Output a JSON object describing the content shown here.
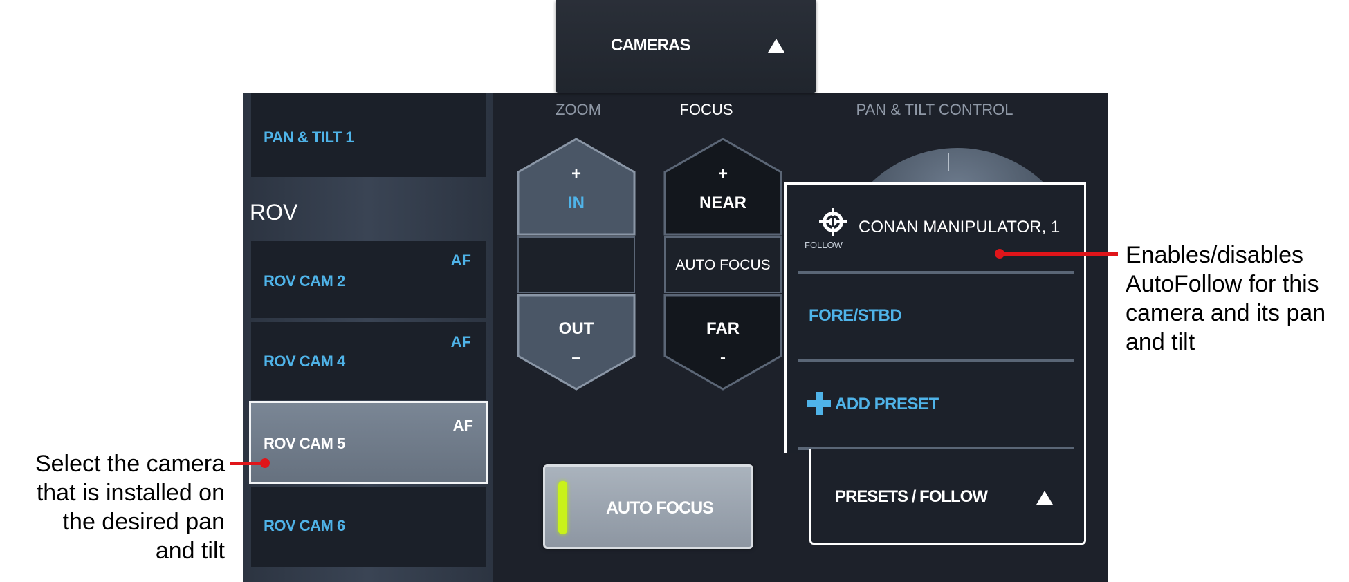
{
  "cameras_tab": {
    "label": "CAMERAS"
  },
  "sidebar": {
    "group_header": "ROV",
    "items": [
      {
        "label": "PAN & TILT 1",
        "af": ""
      },
      {
        "label": "ROV CAM 2",
        "af": "AF"
      },
      {
        "label": "ROV CAM 4",
        "af": "AF"
      },
      {
        "label": "ROV CAM 5",
        "af": "AF",
        "selected": true
      },
      {
        "label": "ROV CAM 6",
        "af": ""
      }
    ]
  },
  "columns": {
    "zoom": "ZOOM",
    "focus": "FOCUS",
    "pan_tilt": "PAN & TILT CONTROL"
  },
  "zoom_control": {
    "plus": "+",
    "in": "IN",
    "out": "OUT",
    "minus": "–"
  },
  "focus_control": {
    "plus": "+",
    "near": "NEAR",
    "auto": "AUTO FOCUS",
    "far": "FAR",
    "minus": "-"
  },
  "auto_focus_button": {
    "label": "AUTO FOCUS",
    "led_color": "#c9f21a"
  },
  "presets": {
    "follow_label": "FOLLOW",
    "items": [
      {
        "label": "CONAN MANIPULATOR, 1"
      },
      {
        "label": "FORE/STBD"
      }
    ],
    "add_label": "ADD PRESET",
    "tab_label": "PRESETS / FOLLOW"
  },
  "annotations": {
    "right": [
      "Enables/disables",
      "AutoFollow for this",
      "camera and its pan",
      "and tilt"
    ],
    "left": [
      "Select the camera",
      "that is installed on",
      "the desired pan",
      "and tilt"
    ]
  },
  "colors": {
    "panel_bg": "#1d212a",
    "accent_blue": "#4fb3e8",
    "callout_red": "#e0151a"
  }
}
